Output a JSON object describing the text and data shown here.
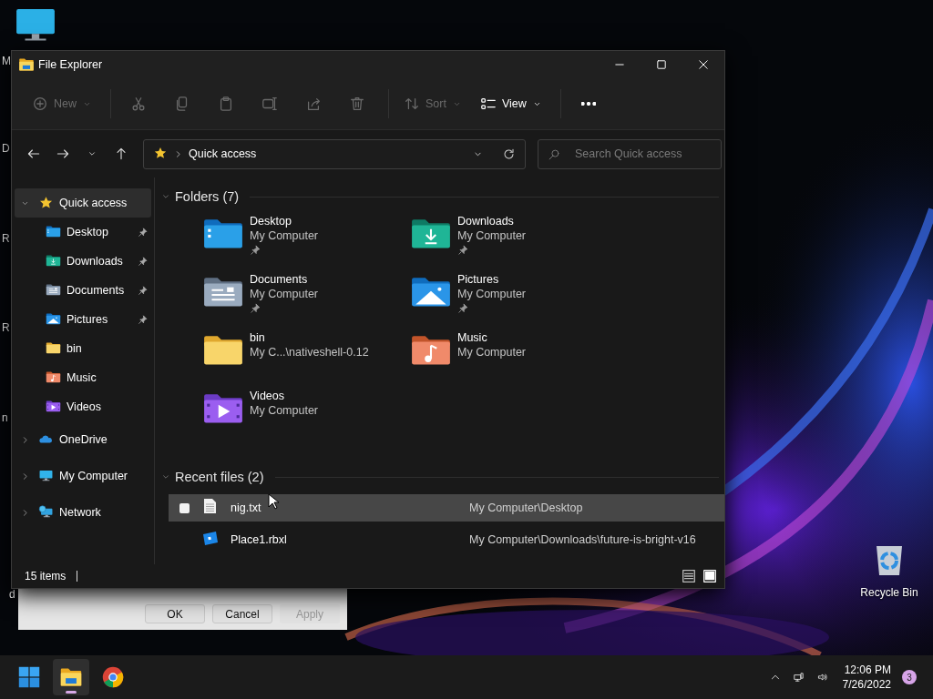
{
  "desktop": {
    "labels": [
      "M",
      "D",
      "R",
      "R",
      "n",
      "d"
    ],
    "recycle_bin": {
      "label": "Recycle Bin"
    }
  },
  "window": {
    "title": "File Explorer"
  },
  "toolbar": {
    "groups": [
      {
        "items": [
          {
            "kind": "new",
            "label": "New",
            "dropdown": true,
            "disabled": true
          }
        ]
      },
      {
        "items": [
          {
            "kind": "cut",
            "dropdown": false,
            "disabled": true
          },
          {
            "kind": "copy",
            "dropdown": false,
            "disabled": true
          },
          {
            "kind": "paste",
            "dropdown": false,
            "disabled": true
          },
          {
            "kind": "rename",
            "dropdown": false,
            "disabled": true
          },
          {
            "kind": "share",
            "dropdown": false,
            "disabled": true
          },
          {
            "kind": "delete",
            "dropdown": false,
            "disabled": true
          }
        ]
      },
      {
        "items": [
          {
            "kind": "sort",
            "label": "Sort",
            "dropdown": true,
            "disabled": true
          },
          {
            "kind": "view",
            "label": "View",
            "dropdown": true,
            "disabled": false
          }
        ]
      },
      {
        "items": [
          {
            "kind": "more",
            "dropdown": false,
            "disabled": false
          }
        ]
      }
    ]
  },
  "nav": [
    {
      "kind": "back"
    },
    {
      "kind": "forward"
    },
    {
      "kind": "recent"
    },
    {
      "kind": "up"
    }
  ],
  "address": {
    "location": "Quick access"
  },
  "search": {
    "placeholder": "Search Quick access"
  },
  "sidebar": {
    "items": [
      {
        "label": "Quick access",
        "kind": "star",
        "selected": true,
        "expanded": true,
        "children": [
          {
            "label": "Desktop",
            "kind": "desktop",
            "pinned": true,
            "selected": false
          },
          {
            "label": "Downloads",
            "kind": "downloads",
            "pinned": true,
            "selected": false
          },
          {
            "label": "Documents",
            "kind": "documents",
            "pinned": true,
            "selected": false
          },
          {
            "label": "Pictures",
            "kind": "pictures",
            "pinned": true,
            "selected": false
          },
          {
            "label": "bin",
            "kind": "bin",
            "pinned": false,
            "selected": false
          },
          {
            "label": "Music",
            "kind": "music",
            "pinned": false,
            "selected": false
          },
          {
            "label": "Videos",
            "kind": "videos",
            "pinned": false,
            "selected": false
          }
        ]
      },
      {
        "label": "OneDrive",
        "kind": "cloud",
        "selected": false,
        "expanded": false
      },
      {
        "label": "My Computer",
        "kind": "computer",
        "selected": false,
        "expanded": false
      },
      {
        "label": "Network",
        "kind": "network",
        "selected": false,
        "expanded": false
      }
    ]
  },
  "folders": {
    "title": "Folders (7)",
    "expanded": true,
    "items": [
      {
        "name": "Desktop",
        "location": "My Computer",
        "pinned": true,
        "kind": "desktop"
      },
      {
        "name": "Downloads",
        "location": "My Computer",
        "pinned": true,
        "kind": "downloads"
      },
      {
        "name": "Documents",
        "location": "My Computer",
        "pinned": true,
        "kind": "documents"
      },
      {
        "name": "Pictures",
        "location": "My Computer",
        "pinned": true,
        "kind": "pictures"
      },
      {
        "name": "bin",
        "location": "My C...\\nativeshell-0.12",
        "pinned": false,
        "kind": "bin"
      },
      {
        "name": "Music",
        "location": "My Computer",
        "pinned": false,
        "kind": "music"
      },
      {
        "name": "Videos",
        "location": "My Computer",
        "pinned": false,
        "kind": "videos"
      }
    ]
  },
  "recent": {
    "title": "Recent files (2)",
    "expanded": true,
    "rows": [
      {
        "name": "nig.txt",
        "location": "My Computer\\Desktop",
        "kind": "text",
        "hovered": true
      },
      {
        "name": "Place1.rbxl",
        "location": "My Computer\\Downloads\\future-is-bright-v16",
        "kind": "place",
        "hovered": false
      }
    ]
  },
  "status_bar": {
    "count": "15 items",
    "views": [
      {
        "kind": "details",
        "selected": false
      },
      {
        "kind": "tiles",
        "selected": true
      }
    ]
  },
  "dialog": {
    "buttons": [
      {
        "label": "OK",
        "disabled": false
      },
      {
        "label": "Cancel",
        "disabled": false
      },
      {
        "label": "Apply",
        "disabled": true
      }
    ]
  },
  "taskbar": {
    "apps": [
      {
        "kind": "start",
        "active": false
      },
      {
        "kind": "explorer",
        "active": true
      },
      {
        "kind": "browser",
        "active": false
      }
    ],
    "tray": {
      "time": "12:06 PM",
      "date": "7/26/2022",
      "notifications": "3"
    }
  }
}
